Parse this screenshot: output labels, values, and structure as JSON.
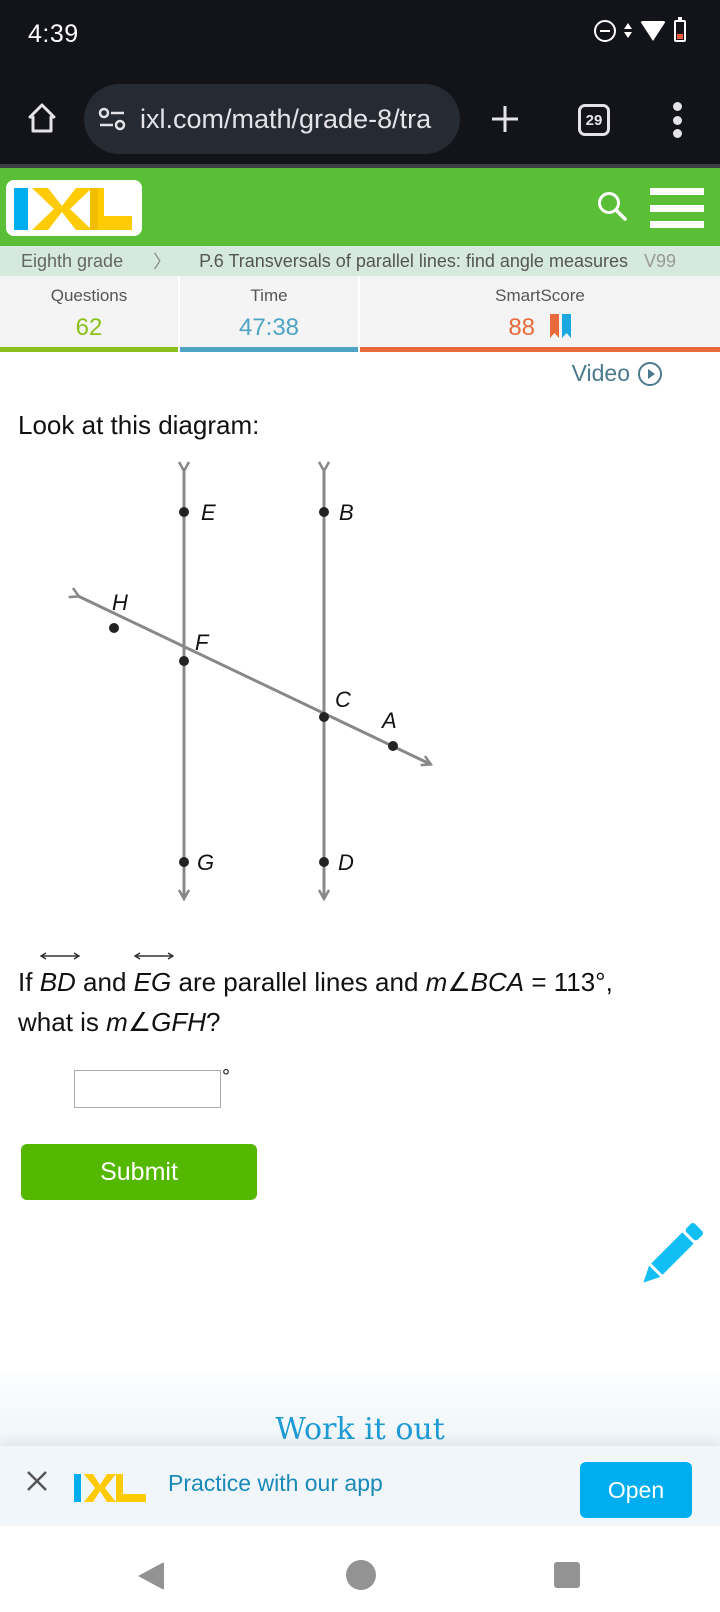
{
  "status_bar": {
    "time": "4:39",
    "icons": [
      "do-not-disturb-icon",
      "data-transfer-icon",
      "wifi-icon",
      "battery-low-icon"
    ]
  },
  "browser": {
    "url": "ixl.com/math/grade-8/tra",
    "tab_count": "29",
    "icons": [
      "home-icon",
      "site-settings-icon",
      "new-tab-plus-icon",
      "tabs-icon",
      "more-options-icon"
    ]
  },
  "header": {
    "logo_text": "IXL",
    "icons": [
      "search-icon",
      "hamburger-menu-icon"
    ],
    "colors": {
      "green": "#5bbe37",
      "logo_blue": "#00aeef",
      "logo_yellow": "#ffcb05"
    }
  },
  "breadcrumb": {
    "grade": "Eighth grade",
    "separator": "〉",
    "skill": "P.6 Transversals of parallel lines: find angle measures",
    "code": "V99"
  },
  "stats": {
    "questions_label": "Questions",
    "questions_value": "62",
    "time_label": "Time",
    "time_value": "47:38",
    "smartscore_label": "SmartScore",
    "smartscore_value": "88",
    "colors": {
      "questions": "#8bc11c",
      "time": "#4ea4c4",
      "smartscore": "#e8693a"
    }
  },
  "video_link": "Video",
  "prompt": "Look at this diagram:",
  "diagram": {
    "points": [
      "E",
      "B",
      "H",
      "F",
      "C",
      "A",
      "G",
      "D"
    ],
    "lines": [
      "line EG",
      "line BD",
      "line HA (transversal)"
    ]
  },
  "question": {
    "if": "If",
    "line1": "BD",
    "and": "and",
    "line2": "EG",
    "mid": "are parallel lines and",
    "given_angle": "m∠BCA",
    "equals": "= 113°,",
    "ask_prefix": "what is",
    "ask_angle": "m∠GFH",
    "ask_suffix": "?"
  },
  "answer": {
    "value": "",
    "placeholder": "",
    "unit": "°"
  },
  "submit_label": "Submit",
  "scratchpad_icon": "pencil-icon",
  "work_it_out": "Work it out",
  "app_banner": {
    "text": "Practice with our app",
    "open_label": "Open"
  },
  "nav": [
    "back-icon",
    "home-circle-icon",
    "recents-icon"
  ]
}
